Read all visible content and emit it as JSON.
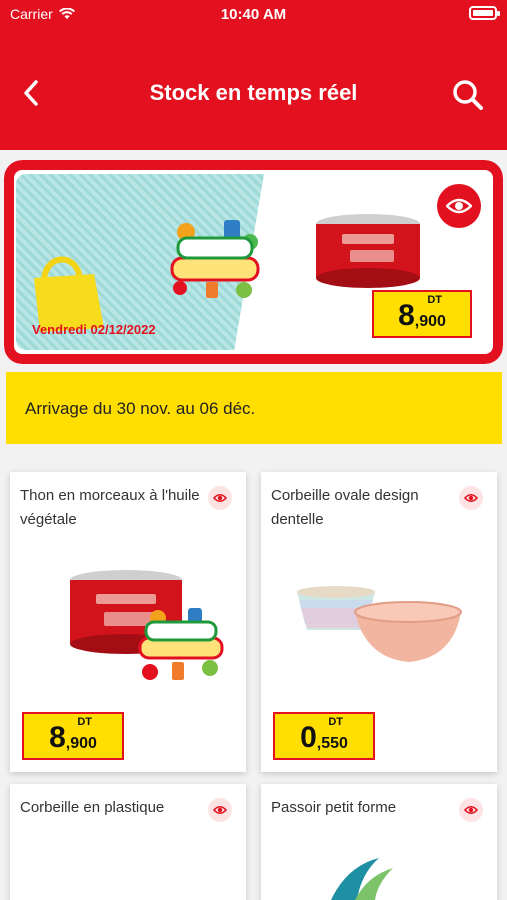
{
  "status_bar": {
    "carrier": "Carrier",
    "time": "10:40 AM"
  },
  "header": {
    "title": "Stock en temps réel"
  },
  "banner": {
    "date": "Vendredi 02/12/2022",
    "price": {
      "integer": "8",
      "decimal": ",900",
      "currency": "DT"
    }
  },
  "arrivage": {
    "text": "Arrivage du 30 nov. au 06 déc."
  },
  "products": [
    {
      "name": "Thon en morceaux à l'huile végétale",
      "price": {
        "integer": "8",
        "decimal": ",900",
        "currency": "DT"
      }
    },
    {
      "name": "Corbeille ovale design dentelle",
      "price": {
        "integer": "0",
        "decimal": ",550",
        "currency": "DT"
      }
    },
    {
      "name": "Corbeille en plastique"
    },
    {
      "name": "Passoir petit forme"
    }
  ],
  "colors": {
    "brand_red": "#e3111f",
    "accent_yellow": "#ffde00"
  },
  "icons": [
    "back-chevron-icon",
    "search-icon",
    "eye-icon",
    "wifi-icon",
    "battery-icon"
  ]
}
